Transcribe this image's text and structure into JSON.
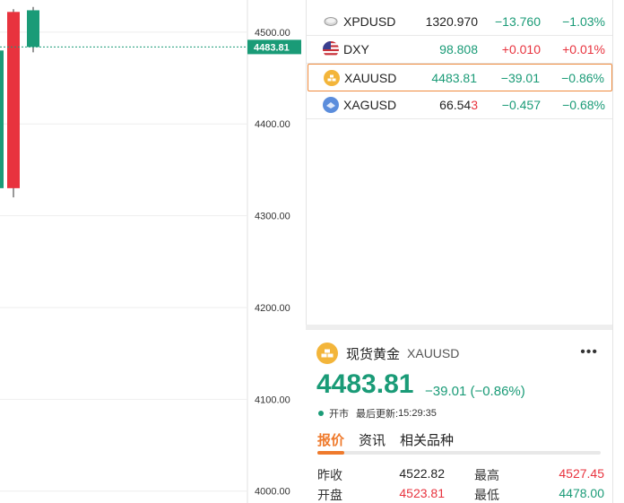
{
  "chart": {
    "y_ticks": [
      "4500.00",
      "4400.00",
      "4300.00",
      "4200.00",
      "4100.00",
      "4000.00"
    ],
    "current_price_label": "4483.81",
    "colors": {
      "up": "#e8333e",
      "down": "#1a9b77",
      "grid": "#eeeeee",
      "price_tag": "#1a9b77"
    }
  },
  "chart_data": {
    "type": "candlestick",
    "ylim": [
      3987,
      4535
    ],
    "y_ticks": [
      4500,
      4400,
      4300,
      4200,
      4100,
      4000
    ],
    "candles": [
      {
        "open": 4480,
        "close": 4330,
        "high": 4480,
        "low": 4320,
        "color": "down"
      },
      {
        "open": 4330,
        "close": 4522,
        "high": 4525,
        "low": 4320,
        "color": "up"
      },
      {
        "open": 4523.81,
        "close": 4483.81,
        "high": 4527.45,
        "low": 4478.0,
        "color": "down"
      }
    ],
    "current_price": 4483.81
  },
  "watchlist": {
    "rows": [
      {
        "symbol": "XPDUSD",
        "price": "1320.970",
        "change": "−13.760",
        "pct": "−1.03%",
        "price_dir": "neutral",
        "dir": "down",
        "icon": "palladium-icon",
        "icon_color": "#cfcfcf"
      },
      {
        "symbol": "DXY",
        "price": "98.808",
        "change": "+0.010",
        "pct": "+0.01%",
        "price_dir": "down",
        "dir": "up",
        "icon": "us-flag-icon",
        "icon_color": "#c9313a"
      },
      {
        "symbol": "XAUUSD",
        "price": "4483.81",
        "change": "−39.01",
        "pct": "−0.86%",
        "price_dir": "down",
        "dir": "down",
        "icon": "gold-icon",
        "icon_color": "#f3b53a"
      },
      {
        "symbol": "XAGUSD",
        "price_main": "66.54",
        "price_last": "3",
        "change": "−0.457",
        "pct": "−0.68%",
        "price_dir": "neutral",
        "dir": "down",
        "icon": "silver-icon",
        "icon_color": "#5b8ddc"
      }
    ]
  },
  "detail": {
    "name": "现货黄金",
    "symbol": "XAUUSD",
    "more": "•••",
    "price": "4483.81",
    "change": "−39.01 (−0.86%)",
    "status": "开市",
    "updated_label": "最后更新:",
    "updated_time": "15:29:35",
    "tabs": [
      "报价",
      "资讯",
      "相关品种"
    ],
    "stats": [
      {
        "label": "昨收",
        "value": "4522.82",
        "label2": "最高",
        "value2": "4527.45"
      },
      {
        "label": "开盘",
        "value": "4523.81",
        "label2": "最低",
        "value2": "4478.00"
      }
    ]
  }
}
